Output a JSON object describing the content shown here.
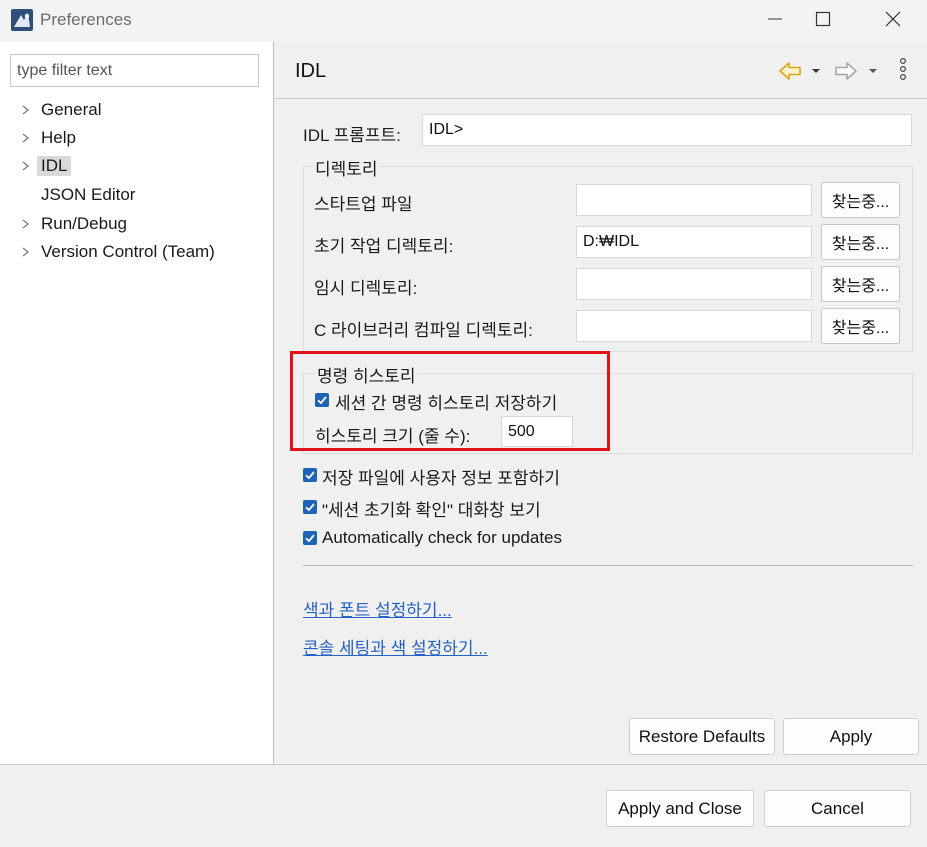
{
  "window": {
    "title": "Preferences",
    "icons": [
      "app-icon",
      "minimize-icon",
      "maximize-icon",
      "close-icon"
    ]
  },
  "left": {
    "filter_placeholder": "type filter text",
    "tree": [
      {
        "label": "General",
        "expandable": true,
        "selected": false
      },
      {
        "label": "Help",
        "expandable": true,
        "selected": false
      },
      {
        "label": "IDL",
        "expandable": true,
        "selected": true
      },
      {
        "label": "JSON Editor",
        "expandable": false,
        "selected": false
      },
      {
        "label": "Run/Debug",
        "expandable": true,
        "selected": false
      },
      {
        "label": "Version Control (Team)",
        "expandable": true,
        "selected": false
      }
    ]
  },
  "page": {
    "title": "IDL",
    "nav_icons": [
      "back-arrow-icon",
      "dropdown-icon",
      "forward-arrow-icon",
      "dropdown-icon",
      "more-options-icon"
    ],
    "prompt": {
      "label": "IDL 프롬프트:",
      "value": "IDL>"
    },
    "directory_group": {
      "title": "디렉토리",
      "rows": [
        {
          "label": "스타트업 파일",
          "value": "",
          "button": "찾는중..."
        },
        {
          "label": "초기 작업 디렉토리:",
          "value": "D:₩IDL",
          "button": "찾는중..."
        },
        {
          "label": "임시 디렉토리:",
          "value": "",
          "button": "찾는중..."
        },
        {
          "label": "C 라이브러리 컴파일 디렉토리:",
          "value": "",
          "button": "찾는중..."
        }
      ]
    },
    "history_group": {
      "title": "명령 히스토리",
      "save_history": {
        "label": "세션 간 명령 히스토리 저장하기",
        "checked": true
      },
      "size": {
        "label": "히스토리 크기 (줄 수):",
        "value": "500"
      }
    },
    "options": [
      {
        "label": "저장 파일에 사용자 정보 포함하기",
        "checked": true
      },
      {
        "label": "\"세션 초기화 확인\" 대화창 보기",
        "checked": true
      },
      {
        "label": "Automatically check for updates",
        "checked": true
      }
    ],
    "links": [
      "색과 폰트 설정하기...",
      "콘솔 세팅과 색 설정하기..."
    ],
    "restore_defaults": "Restore Defaults",
    "apply": "Apply"
  },
  "footer": {
    "apply_and_close": "Apply and Close",
    "cancel": "Cancel"
  },
  "colors": {
    "accent": "#1e64b4",
    "link": "#2661c6",
    "highlight": "#e0121a",
    "back_arrow": "#e2a10f"
  }
}
